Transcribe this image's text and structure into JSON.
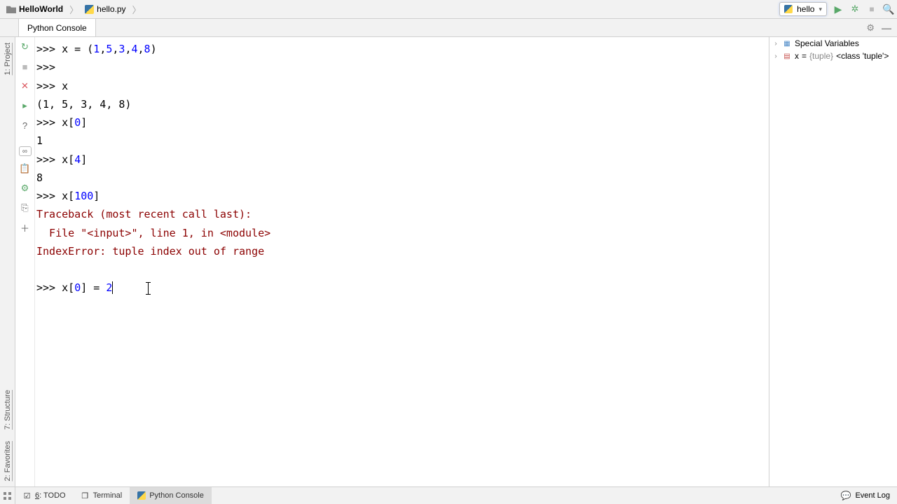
{
  "breadcrumb": {
    "project": "HelloWorld",
    "file": "hello.py"
  },
  "run_config": "hello",
  "tool_tab": "Python Console",
  "left_edge": {
    "project": "1: Project",
    "structure": "7: Structure",
    "favorites": "2: Favorites"
  },
  "console": {
    "l1_prompt": ">>> ",
    "l1_a": "x = (",
    "l1_n1": "1",
    "l1_c1": ",",
    "l1_n2": "5",
    "l1_c2": ",",
    "l1_n3": "3",
    "l1_c3": ",",
    "l1_n4": "4",
    "l1_c4": ",",
    "l1_n5": "8",
    "l1_b": ")",
    "l2": ">>> ",
    "l3": ">>> x",
    "l4": "(1, 5, 3, 4, 8)",
    "l5_p": ">>> ",
    "l5_a": "x[",
    "l5_n": "0",
    "l5_b": "]",
    "l6": "1",
    "l7_p": ">>> ",
    "l7_a": "x[",
    "l7_n": "4",
    "l7_b": "]",
    "l8": "8",
    "l9_p": ">>> ",
    "l9_a": "x[",
    "l9_n": "100",
    "l9_b": "]",
    "l10": "Traceback (most recent call last):",
    "l11": "  File \"<input>\", line 1, in <module>",
    "l12": "IndexError: tuple index out of range",
    "l13_p": ">>> ",
    "l13_a": "x[",
    "l13_n": "0",
    "l13_b": "] = ",
    "l13_v": "2"
  },
  "vars": {
    "special": "Special Variables",
    "x_name": "x",
    "x_eq": " = ",
    "x_type": "{tuple}",
    "x_class": " <class 'tuple'>"
  },
  "bottom": {
    "todo": "6: TODO",
    "terminal": "Terminal",
    "python_console": "Python Console",
    "event_log": "Event Log"
  }
}
